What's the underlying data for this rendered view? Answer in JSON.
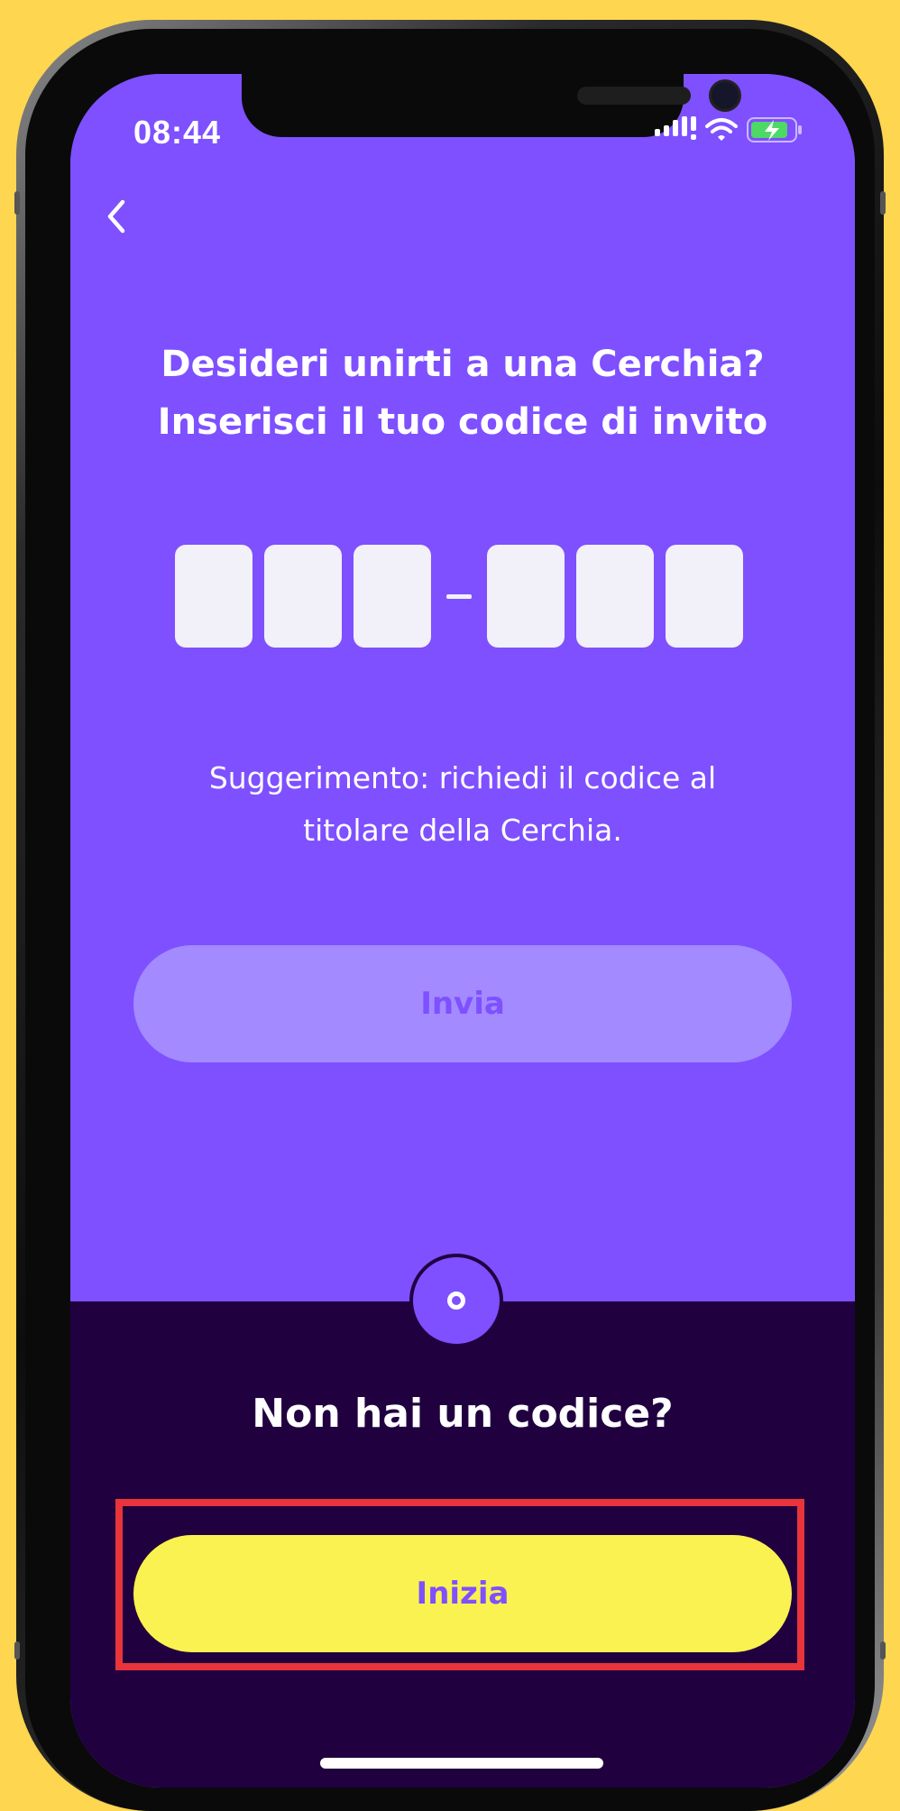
{
  "status_bar": {
    "time": "08:44"
  },
  "header": {
    "title_line1": "Desideri unirti a una Cerchia?",
    "title_line2": "Inserisci il tuo codice di invito"
  },
  "code_input": {
    "separator": "-"
  },
  "hint": {
    "line1": "Suggerimento: richiedi il codice al",
    "line2": "titolare della Cerchia."
  },
  "send_button": {
    "label": "Invia"
  },
  "bottom_panel": {
    "question": "Non hai un codice?",
    "start_label": "Inizia"
  },
  "colors": {
    "background": "#FFD64F",
    "primary_purple": "#7E50FF",
    "dark_purple": "#210040",
    "disabled_button": "#A38AFF",
    "yellow_button": "#FAF250",
    "highlight_red": "#E8343A"
  },
  "icons": {
    "back": "chevron-left-icon",
    "signal": "signal-icon",
    "wifi": "wifi-icon",
    "battery": "battery-charging-icon",
    "circle": "circle-icon"
  }
}
